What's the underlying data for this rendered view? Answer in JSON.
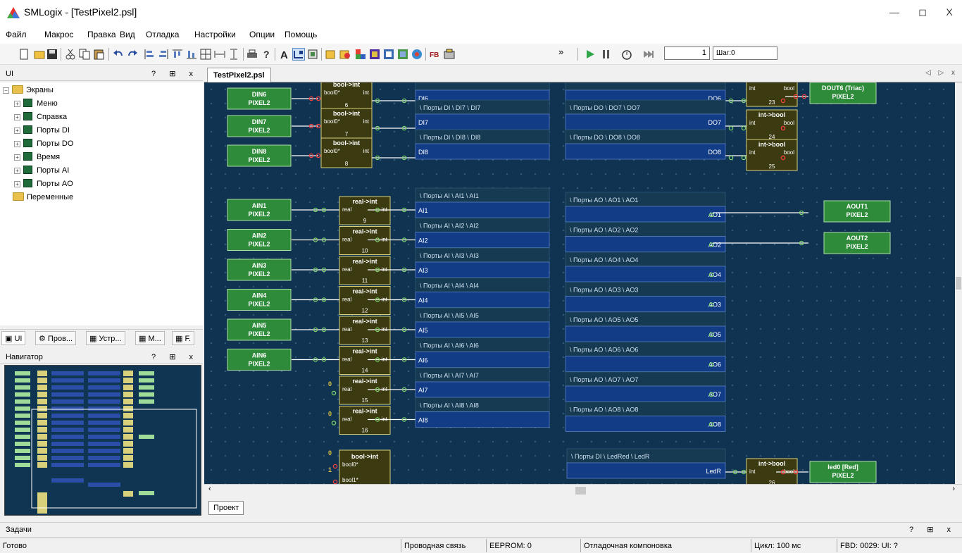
{
  "window": {
    "title": "SMLogix - [TestPixel2.psl]",
    "minimize": "—",
    "restore": "◻",
    "close": "X"
  },
  "menu": [
    "Файл",
    "Макрос",
    "Правка",
    "Вид",
    "Отладка",
    "Настройки",
    "Опции",
    "Помощь"
  ],
  "toolbar": {
    "step_value": "1",
    "step_label": "Шаг:0",
    "overflow": "»"
  },
  "ui_panel": {
    "title": "UI",
    "controls": "? ⊞ x",
    "tree": {
      "root": "Экраны",
      "screens": [
        "Меню",
        "Справка",
        "Порты DI",
        "Порты DO",
        "Время",
        "Порты AI",
        "Порты AO"
      ],
      "variables": "Переменные"
    },
    "tabs": [
      "UI",
      "Пров...",
      "Устр...",
      "М...",
      "F."
    ]
  },
  "navigator": {
    "title": "Навигатор",
    "controls": "? ⊞ x"
  },
  "document": {
    "tab": "TestPixel2.psl",
    "tab_arrows": "◁ ▷ x",
    "project_tab": "Проект"
  },
  "diagram": {
    "pixel_label": "PIXEL2",
    "inputs_di": [
      "DIN6",
      "DIN7",
      "DIN8"
    ],
    "inputs_ai": [
      "AIN1",
      "AIN2",
      "AIN3",
      "AIN4",
      "AIN5",
      "AIN6"
    ],
    "conv_bool_int": {
      "title": "bool->int",
      "in": "bool0*",
      "out": "int",
      "nums": [
        "6",
        "7",
        "8"
      ]
    },
    "conv_real_int": {
      "title": "real->int",
      "in": "real",
      "out": "int",
      "nums": [
        "9",
        "10",
        "11",
        "12",
        "13",
        "14",
        "15",
        "16"
      ]
    },
    "conv_int_bool": {
      "title": "int->bool",
      "in": "int",
      "out": "bool",
      "nums": [
        "23",
        "24",
        "25",
        "26"
      ]
    },
    "di_ports": [
      {
        "header": "",
        "var": "DI6"
      },
      {
        "header": "\\ Порты DI \\ DI7 \\ DI7",
        "var": "DI7"
      },
      {
        "header": "\\ Порты DI \\ DI8 \\ DI8",
        "var": "DI8"
      }
    ],
    "do_ports": [
      {
        "header": "",
        "var": "DO6"
      },
      {
        "header": "\\ Порты DO \\ DO7 \\ DO7",
        "var": "DO7"
      },
      {
        "header": "\\ Порты DO \\ DO8 \\ DO8",
        "var": "DO8"
      }
    ],
    "ai_ports": [
      {
        "header": "\\ Порты AI \\ AI1 \\ AI1",
        "var": "AI1"
      },
      {
        "header": "\\ Порты AI \\ AI2 \\ AI2",
        "var": "AI2"
      },
      {
        "header": "\\ Порты AI \\ AI3 \\ AI3",
        "var": "AI3"
      },
      {
        "header": "\\ Порты AI \\ AI4 \\ AI4",
        "var": "AI4"
      },
      {
        "header": "\\ Порты AI \\ AI5 \\ AI5",
        "var": "AI5"
      },
      {
        "header": "\\ Порты AI \\ AI6 \\ AI6",
        "var": "AI6"
      },
      {
        "header": "\\ Порты AI \\ AI7 \\ AI7",
        "var": "AI7"
      },
      {
        "header": "\\ Порты AI \\ AI8 \\ AI8",
        "var": "AI8"
      }
    ],
    "ao_ports": [
      {
        "header": "\\ Порты AO \\ AO1 \\ AO1",
        "var": "AO1"
      },
      {
        "header": "\\ Порты AO \\ AO2 \\ AO2",
        "var": "AO2"
      },
      {
        "header": "\\ Порты AO \\ AO4 \\ AO4",
        "var": "AO4"
      },
      {
        "header": "\\ Порты AO \\ AO3 \\ AO3",
        "var": "AO3"
      },
      {
        "header": "\\ Порты AO \\ AO5 \\ AO5",
        "var": "AO5"
      },
      {
        "header": "\\ Порты AO \\ AO6 \\ AO6",
        "var": "AO6"
      },
      {
        "header": "\\ Порты AO \\ AO7 \\ AO7",
        "var": "AO7"
      },
      {
        "header": "\\ Порты AO \\ AO8 \\ AO8",
        "var": "AO8"
      }
    ],
    "outputs_right": [
      "DOUT6 (Triac)",
      "AOUT1",
      "AOUT2",
      "led0 [Red]"
    ],
    "led_port": {
      "header": "\\ Порты DI \\ LedRed \\ LedR",
      "var": "LedR"
    },
    "bottom_conv": {
      "title": "bool->int",
      "in0": "bool0*",
      "in1": "bool1*",
      "zero": "0",
      "one": "1"
    },
    "const_zero": "0"
  },
  "tasks": {
    "title": "Задачи",
    "controls": "? ⊞ x"
  },
  "status": {
    "ready": "Готово",
    "link": "Проводная связь",
    "eeprom": "EEPROM: 0",
    "layout": "Отладочная компоновка",
    "cycle": "Цикл: 100 мс",
    "fbd": "FBD: 0029: UI: ?"
  },
  "colors": {
    "canvas": "#0f3350",
    "input_block": "#2e8b3a",
    "conv_block": "#3b3a10",
    "port_block": "#123c86",
    "wire": "#ffffff",
    "pin_red": "#ff4040",
    "pin_green": "#7fd36b"
  }
}
